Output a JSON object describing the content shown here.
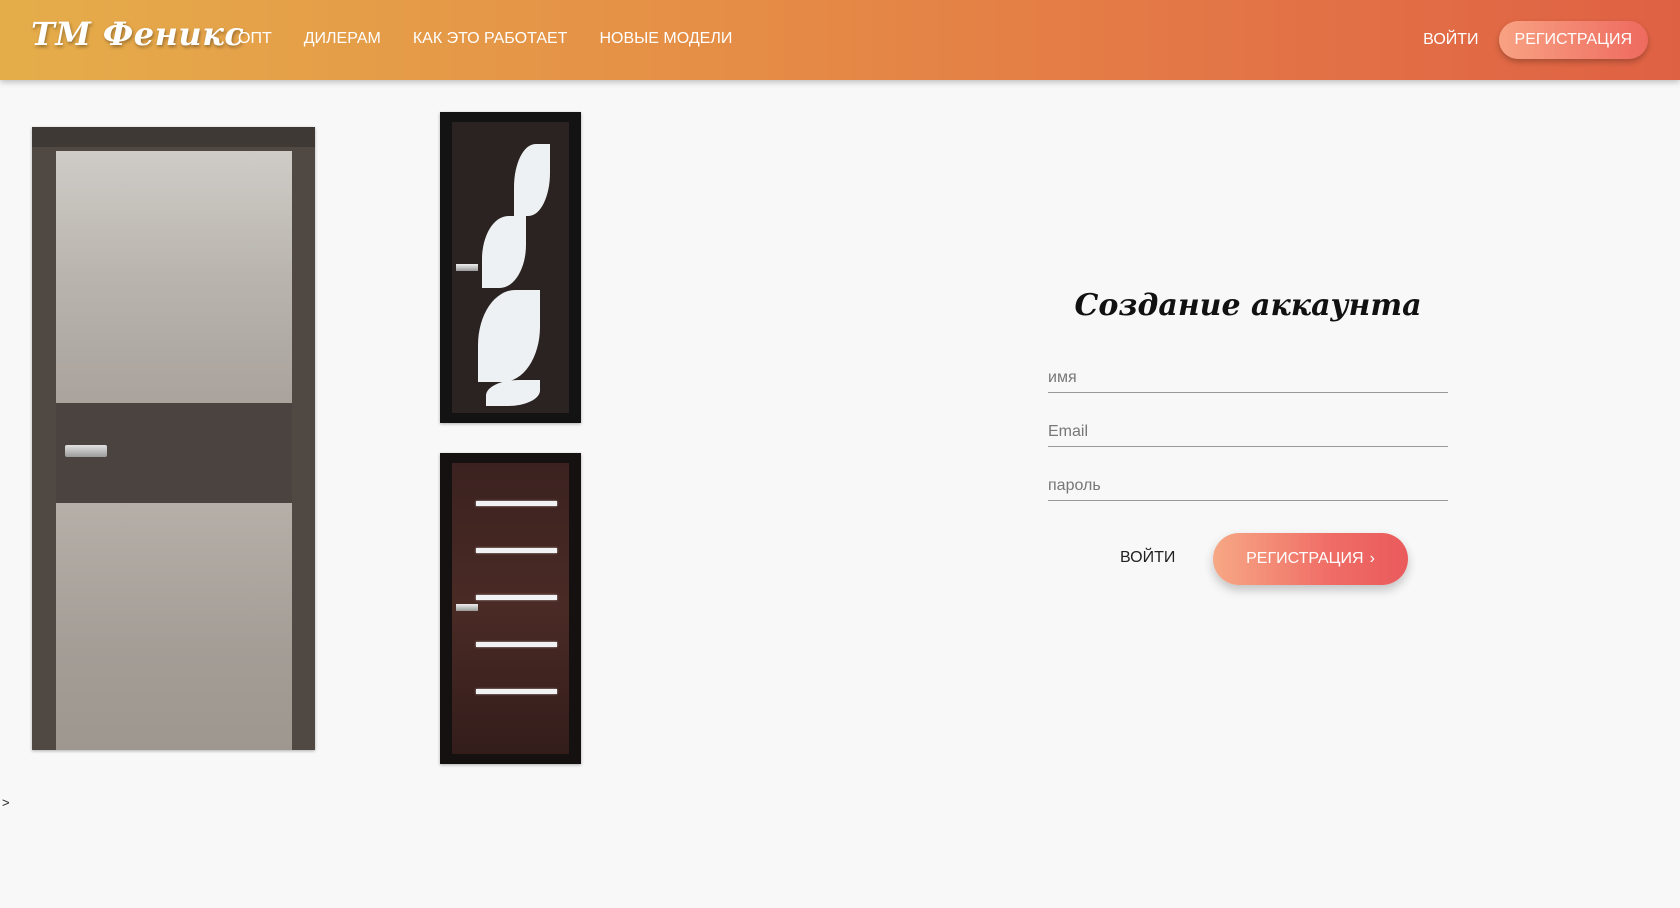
{
  "header": {
    "brand": "ТМ Феникс",
    "nav": [
      "ОПТ",
      "ДИЛЕРАМ",
      "КАК ЭТО РАБОТАЕТ",
      "НОВЫЕ МОДЕЛИ"
    ],
    "login": "ВОЙТИ",
    "register": "РЕГИСТРАЦИЯ"
  },
  "stray_text": ">",
  "form": {
    "title": "Создание аккаунта",
    "name_placeholder": "имя",
    "email_placeholder": "Email",
    "password_placeholder": "пароль",
    "login": "ВОЙТИ",
    "register": "РЕГИСТРАЦИЯ",
    "register_icon": "chevron-right-icon"
  },
  "colors": {
    "header_gradient_start": "#e5ad4a",
    "header_gradient_end": "#df6144",
    "button_gradient_start": "#f7a885",
    "button_gradient_end": "#ea5a5c",
    "background": "#f8f8f8"
  }
}
